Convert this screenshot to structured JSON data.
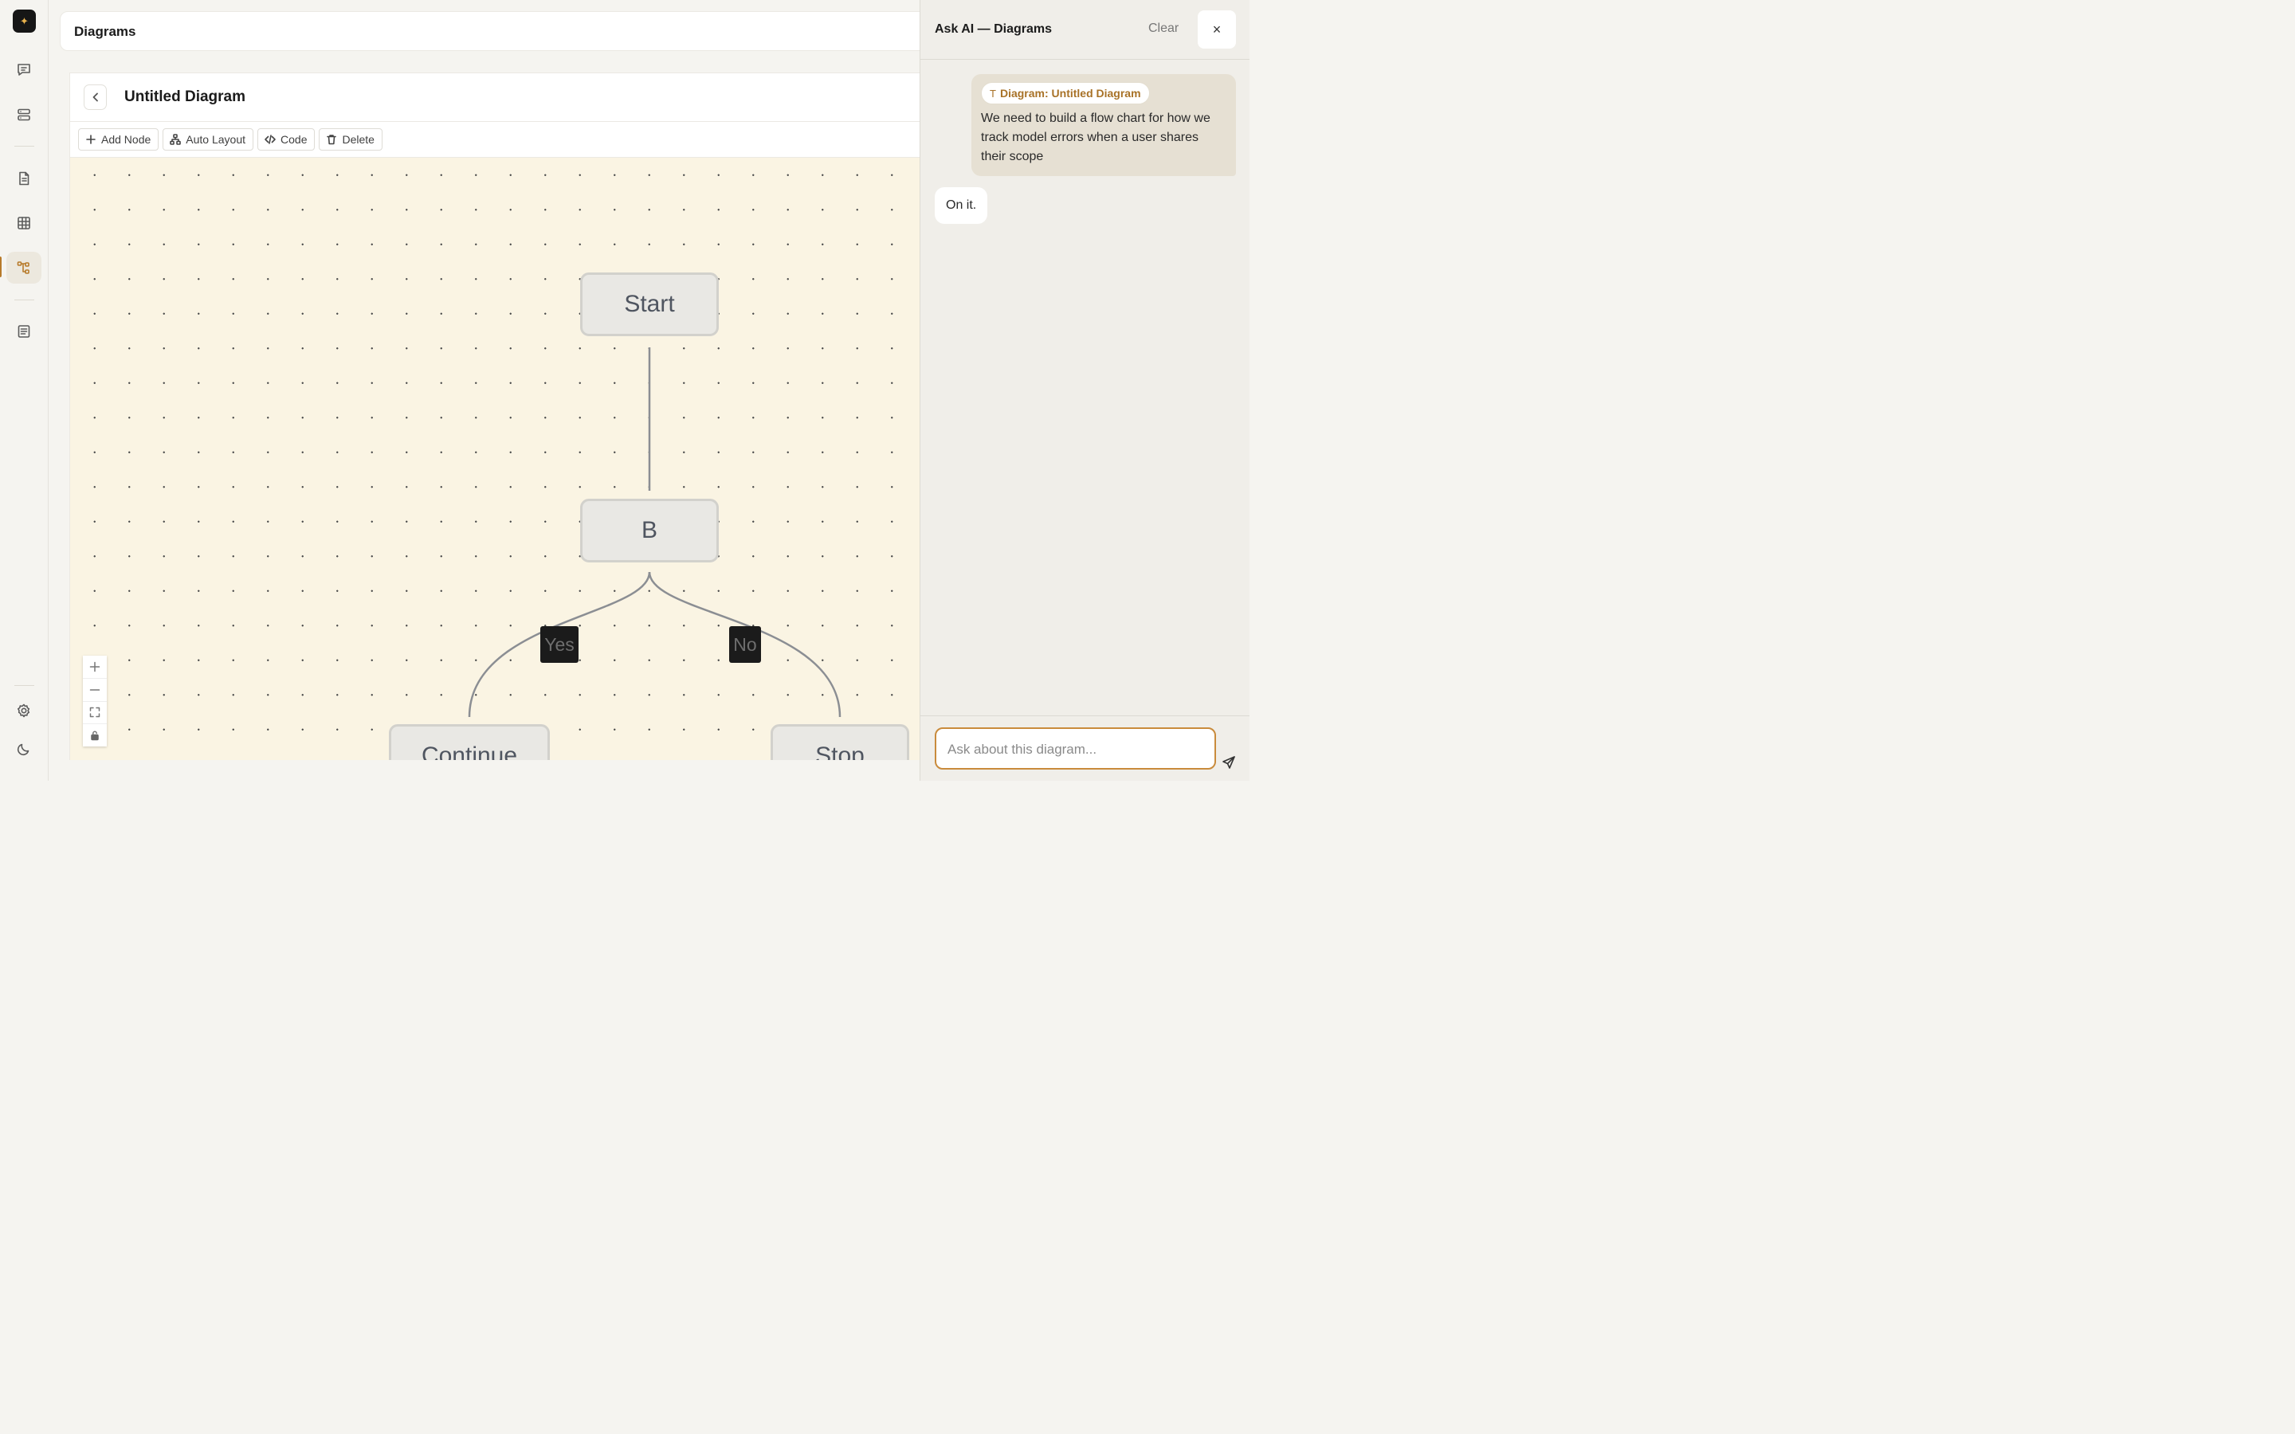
{
  "app": {
    "header_title": "Diagrams"
  },
  "rail": {
    "items": [
      {
        "name": "chat-icon"
      },
      {
        "name": "database-icon"
      },
      {
        "name": "document-icon"
      },
      {
        "name": "table-icon"
      },
      {
        "name": "diagram-icon",
        "active": true
      },
      {
        "name": "notes-icon"
      },
      {
        "name": "settings-icon"
      },
      {
        "name": "moon-icon"
      }
    ]
  },
  "diagram": {
    "title": "Untitled Diagram",
    "toolbar": {
      "add_node": "Add Node",
      "auto_layout": "Auto Layout",
      "code": "Code",
      "delete": "Delete"
    },
    "nodes": {
      "start": "Start",
      "b": "B",
      "continue": "Continue",
      "stop": "Stop"
    },
    "edges": {
      "yes": "Yes",
      "no": "No"
    },
    "colors": {
      "canvas": "#faf4e3",
      "node_fill": "#e9e8e4",
      "edge": "#8b8e93",
      "edge_label_bg": "#1b1b1b"
    }
  },
  "ai_panel": {
    "title": "Ask AI — Diagrams",
    "clear_label": "Clear",
    "close_label": "×",
    "messages": [
      {
        "role": "user",
        "context_chip": "Diagram: Untitled Diagram",
        "text": "We need to build a flow chart for how we track model errors when a user shares their scope"
      },
      {
        "role": "assistant",
        "text": "On it."
      }
    ],
    "input_placeholder": "Ask about this diagram...",
    "accent": "#c98b3c"
  }
}
